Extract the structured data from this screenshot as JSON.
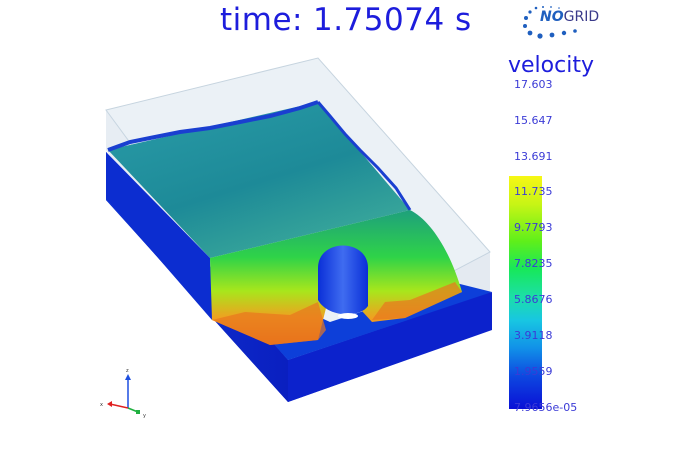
{
  "header": {
    "time_label": "time:",
    "time_value": "1.75074 s"
  },
  "logo": {
    "brand_no": "NO",
    "brand_grid": "GRID"
  },
  "legend": {
    "title": "velocity",
    "ticks": [
      "17.603",
      "15.647",
      "13.691",
      "11.735",
      "9.7793",
      "7.8235",
      "5.8676",
      "3.9118",
      "1.9559",
      "7.9656e-05"
    ],
    "colors": {
      "high": "#f7f715",
      "mid": "#17e85a",
      "low": "#0a10d6"
    }
  },
  "axes": {
    "x_label": "x",
    "y_label": "y",
    "z_label": "z"
  },
  "colors": {
    "title_text": "#1d1ddc",
    "tick_text": "#3b3bd6",
    "water_surface": "#1e8fa0",
    "base_block": "#0a20c8"
  }
}
